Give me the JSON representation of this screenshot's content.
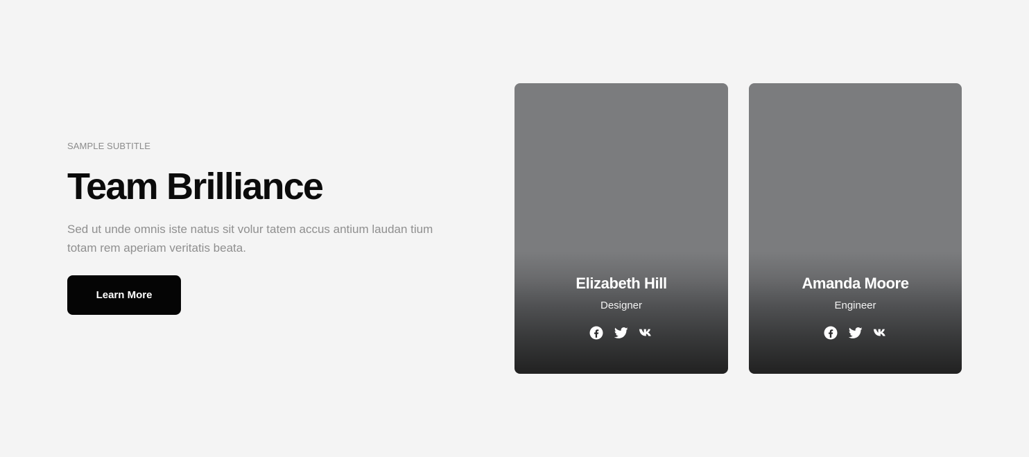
{
  "intro": {
    "subtitle": "SAMPLE SUBTITLE",
    "title": "Team Brilliance",
    "description": "Sed ut unde omnis iste natus sit volur tatem accus antium laudan tium totam rem aperiam veritatis beata.",
    "button_label": "Learn More"
  },
  "team": [
    {
      "name": "Elizabeth Hill",
      "role": "Designer",
      "socials": [
        "facebook-icon",
        "twitter-icon",
        "vk-icon"
      ]
    },
    {
      "name": "Amanda Moore",
      "role": "Engineer",
      "socials": [
        "facebook-icon",
        "twitter-icon",
        "vk-icon"
      ]
    }
  ],
  "colors": {
    "background": "#f4f4f4",
    "heading": "#0b0b0b",
    "muted_text": "#8f8f8f",
    "button_bg": "#050505",
    "button_text": "#ffffff",
    "card_top": "#7b7c7e",
    "card_bottom": "#212121"
  }
}
